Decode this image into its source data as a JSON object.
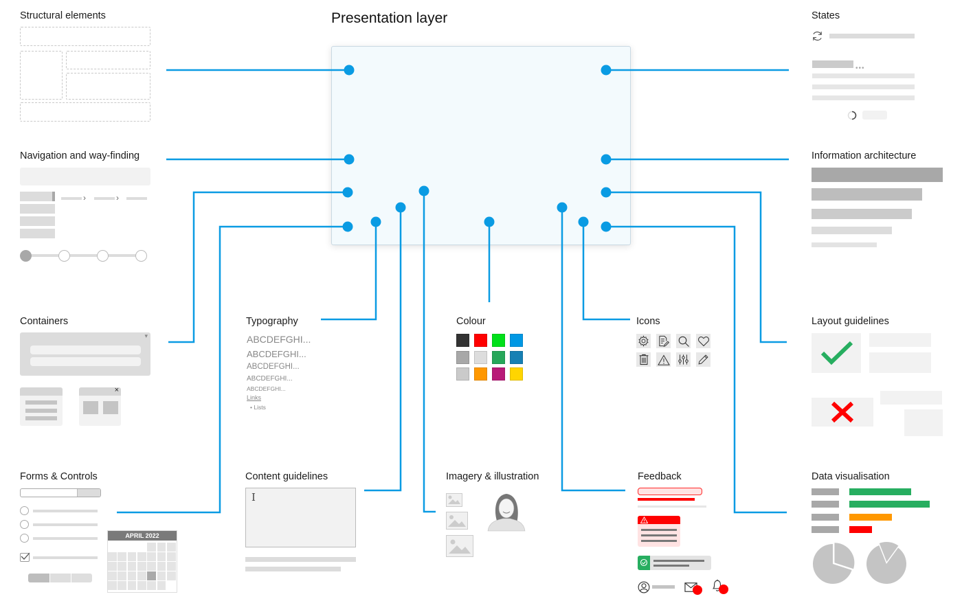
{
  "center": {
    "title": "Presentation layer"
  },
  "sections": {
    "structural": {
      "title": "Structural elements"
    },
    "navigation": {
      "title": "Navigation and way-finding"
    },
    "containers": {
      "title": "Containers",
      "close_glyph": "×",
      "caret_glyph": "▾"
    },
    "forms": {
      "title": "Forms & Controls",
      "calendar_month": "APRIL 2022"
    },
    "typography": {
      "title": "Typography",
      "samples": [
        "ABCDEFGHI...",
        "ABCDEFGHI...",
        "ABCDEFGHI...",
        "ABCDEFGHI...",
        "ABCDEFGHI..."
      ],
      "link_label": "Links",
      "list_label": "Lists"
    },
    "content": {
      "title": "Content guidelines"
    },
    "colour": {
      "title": "Colour",
      "swatches": [
        "#333333",
        "#ff0000",
        "#00e01a",
        "#0098e4",
        "#a8a8a8",
        "#dddddd",
        "#27a75a",
        "#1680b4",
        "#cacaca",
        "#ff9800",
        "#b81a78",
        "#ffd500"
      ]
    },
    "imagery": {
      "title": "Imagery & illustration"
    },
    "icons": {
      "title": "Icons",
      "items": [
        "gear-icon",
        "document-edit-icon",
        "search-icon",
        "heart-icon",
        "trash-icon",
        "warning-icon",
        "sliders-icon",
        "pencil-icon"
      ]
    },
    "feedback": {
      "title": "Feedback"
    },
    "states": {
      "title": "States"
    },
    "info_arch": {
      "title": "Information architecture"
    },
    "layout": {
      "title": "Layout guidelines"
    },
    "dataviz": {
      "title": "Data visualisation",
      "bars": [
        {
          "value": 0.77,
          "color": "#27ae60"
        },
        {
          "value": 1.0,
          "color": "#27ae60"
        },
        {
          "value": 0.53,
          "color": "#ff9800"
        },
        {
          "value": 0.28,
          "color": "#ff0000"
        }
      ],
      "pies": [
        {
          "slice_fraction": 0.3
        },
        {
          "slice_fraction": 0.16
        }
      ]
    }
  },
  "colors": {
    "connector": "#0a9be3",
    "success": "#27ae60",
    "error": "#ff0000"
  }
}
